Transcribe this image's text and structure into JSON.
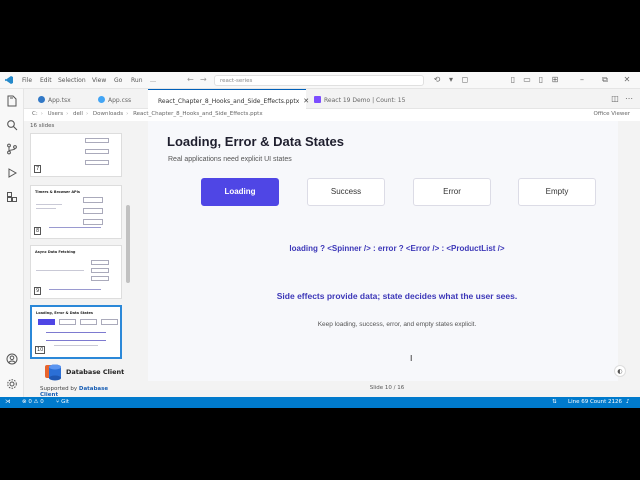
{
  "titlebar": {
    "menu": [
      "File",
      "Edit",
      "Selection",
      "View",
      "Go",
      "Run"
    ],
    "more": "…",
    "nav_back": "←",
    "nav_forward": "→",
    "command_center": "react-series"
  },
  "tabs": [
    {
      "label": "App.tsx",
      "icon_color": "#3178c6"
    },
    {
      "label": "App.css",
      "icon_color": "#42a5f5"
    },
    {
      "label": "React_Chapter_8_Hooks_and_Side_Effects.pptx",
      "icon_color": "#d24726"
    },
    {
      "label": "React 19 Demo | Count: 15",
      "icon_color": "#7c4dff"
    }
  ],
  "tab_close": "✕",
  "breadcrumb": {
    "parts": [
      "C:",
      "Users",
      "dell",
      "Downloads",
      "React_Chapter_8_Hooks_and_Side_Effects.pptx"
    ],
    "viewer": "Office Viewer"
  },
  "thumbs": {
    "count_label": "16 slides",
    "items": [
      {
        "num": "7",
        "title": ""
      },
      {
        "num": "8",
        "title": "Timers & Browser APIs"
      },
      {
        "num": "9",
        "title": "Async Data Fetching"
      },
      {
        "num": "10",
        "title": "Loading, Error & Data States"
      }
    ]
  },
  "sponsor": {
    "name": "Database Client",
    "supported_prefix": "Supported by ",
    "supported_link": "Database Client"
  },
  "slide": {
    "title": "Loading, Error & Data States",
    "subtitle": "Real applications need explicit UI states",
    "states": [
      "Loading",
      "Success",
      "Error",
      "Empty"
    ],
    "code": "loading ? <Spinner /> : error ? <Error /> : <ProductList />",
    "main": "Side effects provide data; state decides what the user sees.",
    "note": "Keep loading, success, error, and empty states explicit."
  },
  "slide_counter": "Slide 10 / 16",
  "status": {
    "errors": "0",
    "warnings": "0",
    "git": "Git",
    "position": "Line 69 Count 2126"
  },
  "colors": {
    "accent": "#4f46e5",
    "statusbar": "#007acc",
    "text_accent": "#3c37b8"
  }
}
